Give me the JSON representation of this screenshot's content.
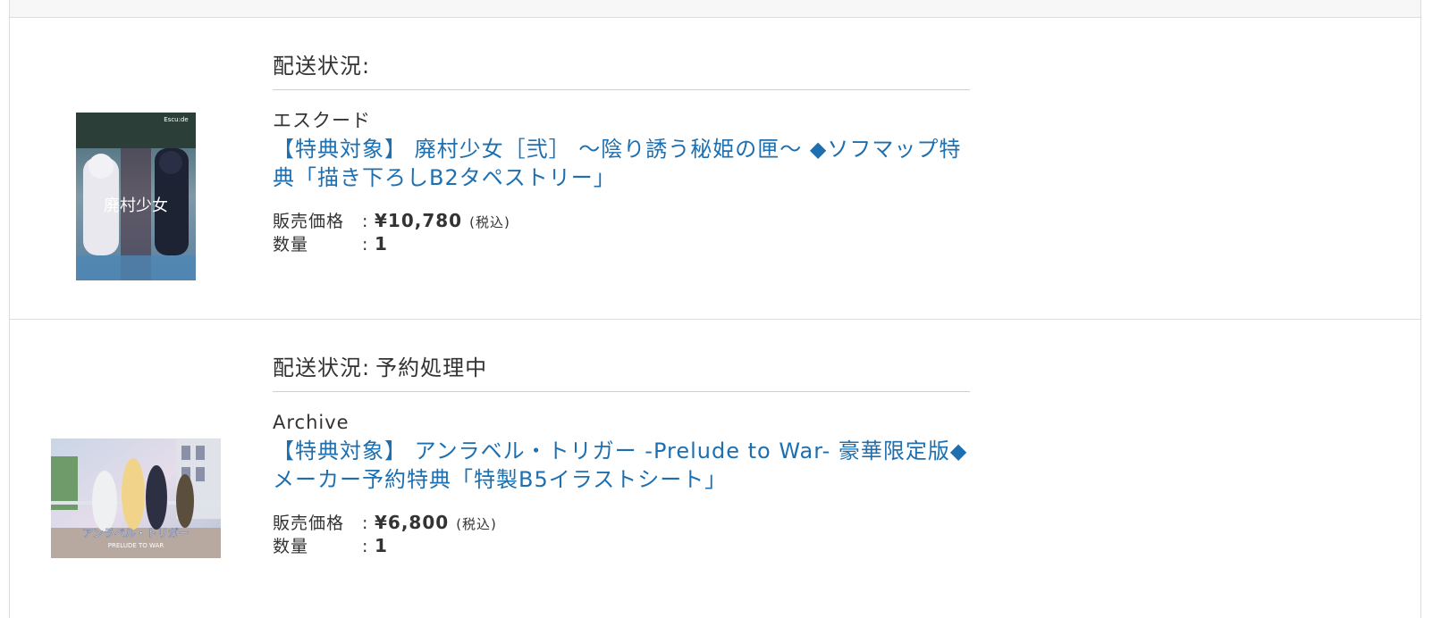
{
  "items": [
    {
      "status_label": "配送状況:",
      "status_value": "",
      "maker": "エスクード",
      "title": "【特典対象】 廃村少女［弐］ ～陰り誘う秘姫の匣～ ◆ソフマップ特典「描き下ろしB2タペストリー」",
      "price_label": "販売価格",
      "price_colon": ":",
      "price": "¥10,780",
      "tax_note": "(税込)",
      "quantity_label": "数量",
      "quantity_colon": ":",
      "quantity": "1",
      "thumb_logo_text": "廃村少女",
      "thumb_brand": "Escu:de"
    },
    {
      "status_label": "配送状況:",
      "status_value": "予約処理中",
      "maker": "Archive",
      "title": "【特典対象】 アンラベル・トリガー -Prelude to War- 豪華限定版◆メーカー予約特典「特製B5イラストシート」",
      "price_label": "販売価格",
      "price_colon": ":",
      "price": "¥6,800",
      "tax_note": "(税込)",
      "quantity_label": "数量",
      "quantity_colon": ":",
      "quantity": "1",
      "thumb_logo_text": "アンラベル・トリガー",
      "thumb_subtitle": "PRELUDE TO WAR"
    }
  ],
  "colors": {
    "link": "#1d6fb0",
    "text": "#333333",
    "divider": "#dcdcdc"
  }
}
